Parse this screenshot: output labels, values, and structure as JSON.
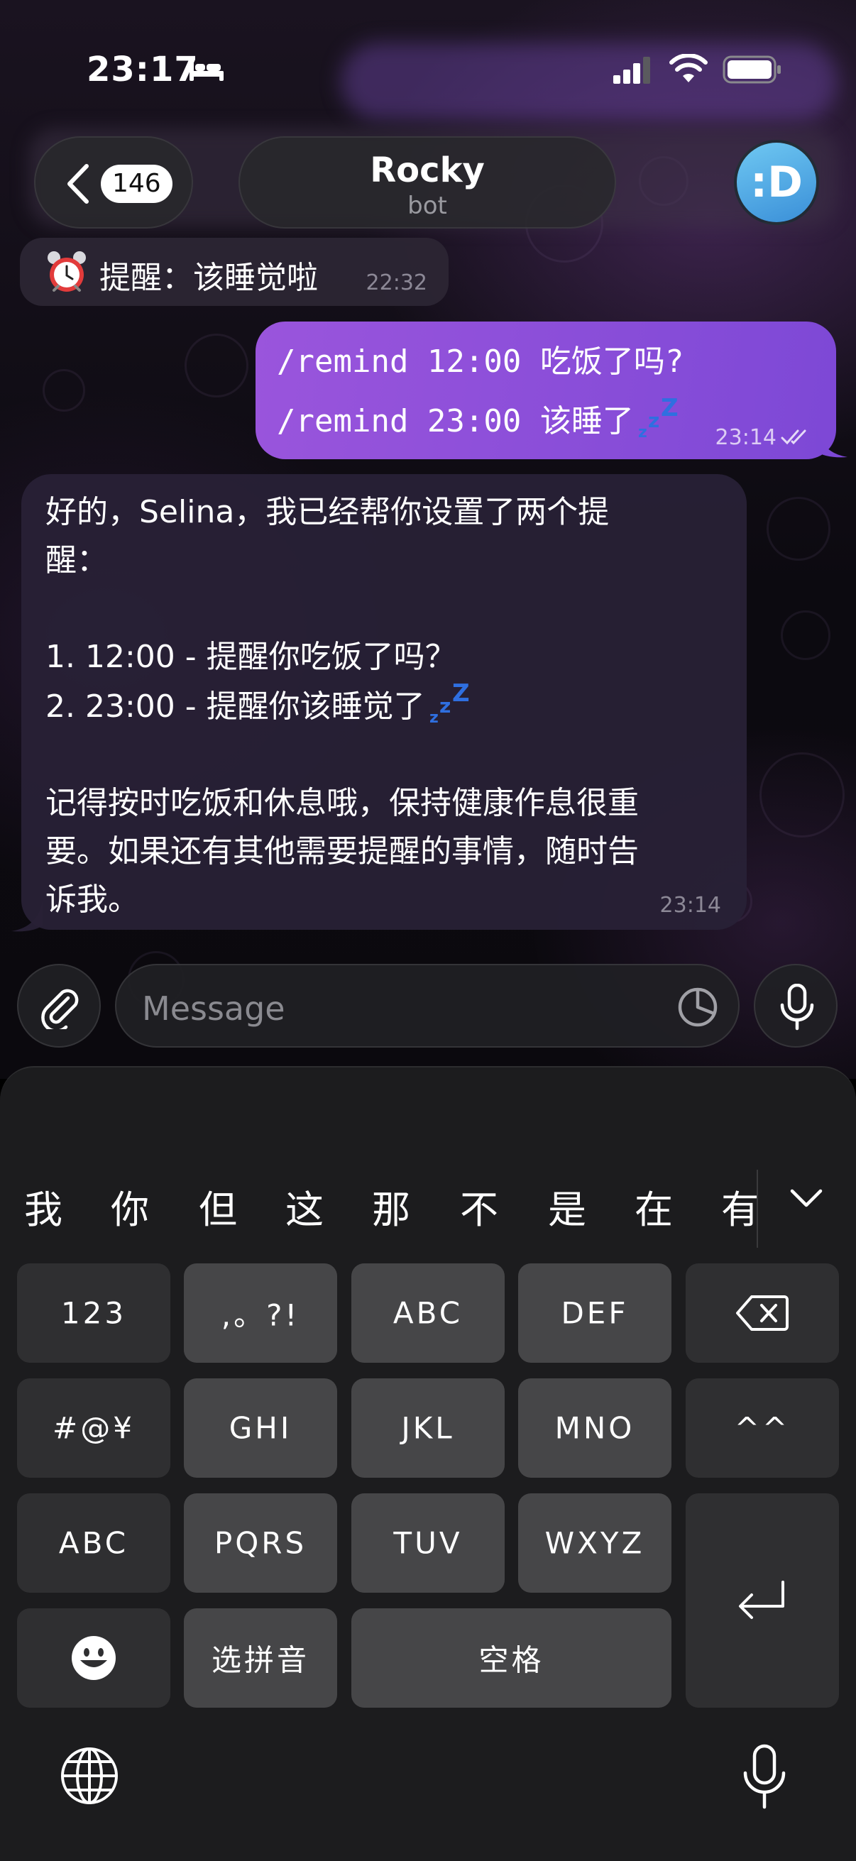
{
  "status_bar": {
    "time": "23:17",
    "icons": [
      "bed-icon",
      "signal-icon",
      "wifi-icon",
      "battery-icon"
    ]
  },
  "header": {
    "back_count": "146",
    "title": "Rocky",
    "subtitle": "bot",
    "avatar_text": ":D",
    "avatar_color": "#4aa8e6"
  },
  "messages": {
    "reminder": {
      "icon": "alarm-clock-icon",
      "text": "提醒：该睡觉啦",
      "time": "22:32"
    },
    "outgoing": {
      "line1": "/remind 12:00 吃饭了吗?",
      "line2": "/remind 23:00 该睡了",
      "time": "23:14",
      "status": "read",
      "color": "#8a4fd9"
    },
    "incoming": {
      "lines": [
        "好的，Selina，我已经帮你设置了两个提",
        "醒：",
        "",
        "1. 12:00 - 提醒你吃饭了吗？",
        "2. 23:00 - 提醒你该睡觉了",
        "",
        "记得按时吃饭和休息哦，保持健康作息很重",
        "要。如果还有其他需要提醒的事情，随时告",
        "诉我。"
      ],
      "time": "23:14"
    }
  },
  "composer": {
    "placeholder": "Message"
  },
  "keyboard": {
    "candidates": [
      "我",
      "你",
      "但",
      "这",
      "那",
      "不",
      "是",
      "在",
      "有"
    ],
    "rows": {
      "r1": [
        "123",
        ",。?!",
        "ABC",
        "DEF"
      ],
      "r2": [
        "#@¥",
        "GHI",
        "JKL",
        "MNO",
        "^^"
      ],
      "r3": [
        "ABC",
        "PQRS",
        "TUV",
        "WXYZ"
      ],
      "r4_pinyin": "选拼音",
      "r4_space": "空格"
    }
  }
}
